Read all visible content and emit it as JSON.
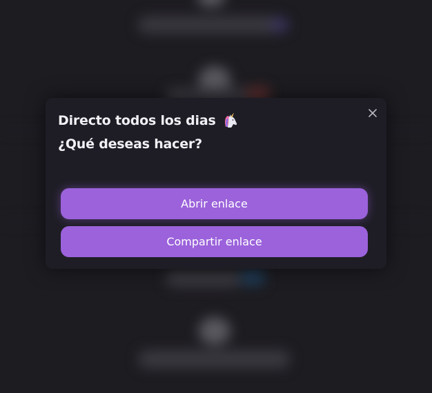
{
  "modal": {
    "title": "Directo todos los dias",
    "title_icon": "unicorn-icon",
    "subtitle": "¿Qué deseas hacer?",
    "close_icon": "close-icon",
    "buttons": [
      {
        "label": "Abrir enlace"
      },
      {
        "label": "Compartir enlace"
      }
    ]
  },
  "colors": {
    "background": "#1d1c21",
    "modal_background": "#1e1d25",
    "button": "#9b62db",
    "text": "#f1f0f5",
    "button_text": "#ffffff"
  }
}
